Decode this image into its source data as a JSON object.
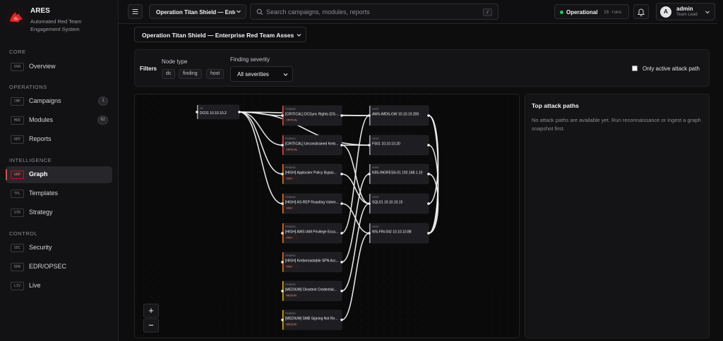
{
  "brand": {
    "name": "ARES",
    "subtitle": "Automated Red Team Engagement System"
  },
  "sidebar": {
    "sections": [
      {
        "title": "CORE",
        "items": [
          {
            "code": "OVR",
            "label": "Overview",
            "badge": ""
          }
        ]
      },
      {
        "title": "OPERATIONS",
        "items": [
          {
            "code": "CMP",
            "label": "Campaigns",
            "badge": "1"
          },
          {
            "code": "MOD",
            "label": "Modules",
            "badge": "62"
          },
          {
            "code": "REP",
            "label": "Reports",
            "badge": ""
          }
        ]
      },
      {
        "title": "INTELLIGENCE",
        "items": [
          {
            "code": "GRP",
            "label": "Graph",
            "badge": "",
            "active": true
          },
          {
            "code": "TPL",
            "label": "Templates",
            "badge": ""
          },
          {
            "code": "STR",
            "label": "Strategy",
            "badge": ""
          }
        ]
      },
      {
        "title": "CONTROL",
        "items": [
          {
            "code": "SEC",
            "label": "Security",
            "badge": ""
          },
          {
            "code": "EDR",
            "label": "EDR/OPSEC",
            "badge": ""
          },
          {
            "code": "LIV",
            "label": "Live",
            "badge": ""
          }
        ]
      }
    ]
  },
  "topbar": {
    "campaign_select": "Operation Titan Shield — Enterprise Red Team Assessment",
    "search_placeholder": "Search campaigns, modules, reports",
    "search_shortcut": "/",
    "status": "Operational",
    "runs": "10 runs",
    "user_initial": "A",
    "user_name": "admin",
    "user_role": "Team Lead"
  },
  "campaign_select_main": "Operation Titan Shield — Enterprise Red Team Assessment",
  "filters": {
    "label": "Filters",
    "node_type_label": "Node type",
    "node_types": [
      "dc",
      "finding",
      "host"
    ],
    "severity_label": "Finding severity",
    "severity_value": "All severities",
    "active_path_label": "Only active attack path"
  },
  "graph": {
    "nodes": [
      {
        "id": "dc",
        "kind": "DC",
        "label": "DC01 10.10.10.2",
        "tag": "",
        "color": "#a1a1aa"
      },
      {
        "id": "f1",
        "kind": "FINDING",
        "label": "[CRITICAL] DCSync Rights (DS-...",
        "tag": "CRITICAL",
        "color": "#ef4444"
      },
      {
        "id": "f2",
        "kind": "FINDING",
        "label": "[CRITICAL] Unconstrained Kerb...",
        "tag": "CRITICAL",
        "color": "#ef4444"
      },
      {
        "id": "f3",
        "kind": "FINDING",
        "label": "[HIGH] Applocker Policy Bypas...",
        "tag": "HIGH",
        "color": "#f97316"
      },
      {
        "id": "f4",
        "kind": "FINDING",
        "label": "[HIGH] AS-REP Roasting Vulner...",
        "tag": "HIGH",
        "color": "#f97316"
      },
      {
        "id": "f5",
        "kind": "FINDING",
        "label": "[HIGH] AWS IAM Privilege Esca...",
        "tag": "HIGH",
        "color": "#f97316"
      },
      {
        "id": "f6",
        "kind": "FINDING",
        "label": "[HIGH] Kerberoastable SPN Acc...",
        "tag": "HIGH",
        "color": "#f97316"
      },
      {
        "id": "f7",
        "kind": "FINDING",
        "label": "[MEDIUM] Cleartext Credential...",
        "tag": "MEDIUM",
        "color": "#eab308"
      },
      {
        "id": "f8",
        "kind": "FINDING",
        "label": "[MEDIUM] SMB Signing Not Re...",
        "tag": "MEDIUM",
        "color": "#eab308"
      },
      {
        "id": "h1",
        "kind": "HOST",
        "label": "AWS-IMDS-GW 10.10.10.200",
        "tag": "",
        "color": "#a1a1aa"
      },
      {
        "id": "h2",
        "kind": "HOST",
        "label": "FS01 10.10.10.20",
        "tag": "",
        "color": "#a1a1aa"
      },
      {
        "id": "h3",
        "kind": "HOST",
        "label": "K8S-INGRESS-01 192.168.1.10",
        "tag": "",
        "color": "#a1a1aa"
      },
      {
        "id": "h4",
        "kind": "HOST",
        "label": "SQL01 10.10.10.15",
        "tag": "",
        "color": "#a1a1aa"
      },
      {
        "id": "h5",
        "kind": "HOST",
        "label": "WS-FIN-042 10.10.10.88",
        "tag": "",
        "color": "#a1a1aa"
      }
    ],
    "edges": [
      [
        "dc",
        "f1"
      ],
      [
        "dc",
        "f2"
      ],
      [
        "dc",
        "f3"
      ],
      [
        "dc",
        "f4"
      ],
      [
        "dc",
        "h1"
      ],
      [
        "dc",
        "h2"
      ],
      [
        "f1",
        "h1"
      ],
      [
        "f2",
        "h2"
      ],
      [
        "f3",
        "h4"
      ],
      [
        "f4",
        "h5"
      ],
      [
        "f5",
        "h1"
      ],
      [
        "f6",
        "h3"
      ],
      [
        "f7",
        "h4"
      ],
      [
        "f8",
        "h5"
      ],
      [
        "h1",
        "h4"
      ],
      [
        "h3",
        "h5"
      ],
      [
        "h2",
        "h5"
      ],
      [
        "h1",
        "h5"
      ],
      [
        "f2",
        "h4"
      ]
    ],
    "zoom_in": "+",
    "zoom_out": "−"
  },
  "attack_paths": {
    "title": "Top attack paths",
    "empty_message": "No attack paths are available yet. Run reconnaissance or ingest a graph snapshot first."
  },
  "colors": {
    "accent": "#ef4444",
    "status_ok": "#22c55e"
  }
}
